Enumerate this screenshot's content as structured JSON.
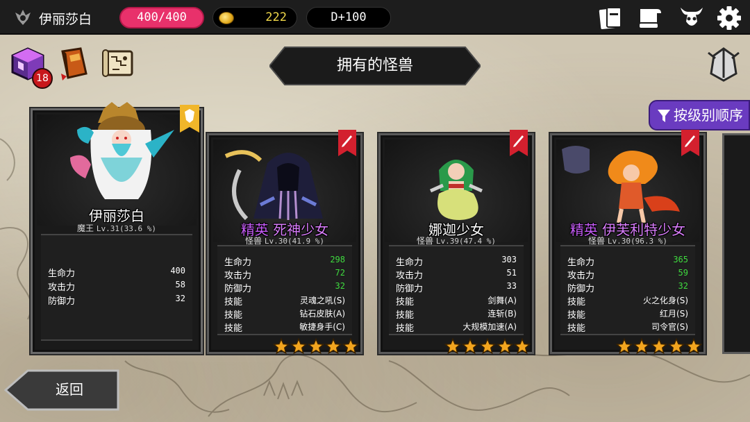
{
  "header": {
    "player_name": "伊丽莎白",
    "hp": "400/400",
    "gold": "222",
    "day": "D+100",
    "icons": [
      "cards-icon",
      "scroll-icon",
      "demon-icon",
      "gear-icon"
    ]
  },
  "menu": {
    "inventory_badge": "18",
    "icons": [
      "inventory-cube-icon",
      "book-icon",
      "map-scroll-icon"
    ]
  },
  "title": "拥有的怪兽",
  "sort_button": "按级别顺序",
  "back_button": "返回",
  "colors": {
    "hp": "#e8316b",
    "gold_text": "#f0d84a",
    "sort": "#6a3bc0",
    "elite": "#c45bf5",
    "stat_bonus": "#3fdc3f",
    "ribbon": "#d3202e"
  },
  "leader": {
    "name": "伊丽莎白",
    "role": "魔王",
    "level": "Lv.31(33.6 %)",
    "stats": [
      {
        "label": "生命力",
        "value": "400"
      },
      {
        "label": "攻击力",
        "value": "58"
      },
      {
        "label": "防御力",
        "value": "32"
      }
    ]
  },
  "monsters": [
    {
      "prefix": "精英",
      "name": "死神少女",
      "role": "怪兽",
      "level": "Lv.30(41.9 %)",
      "stars": 5,
      "stats": [
        {
          "label": "生命力",
          "value": "298",
          "bonus": true
        },
        {
          "label": "攻击力",
          "value": "72",
          "bonus": true
        },
        {
          "label": "防御力",
          "value": "32",
          "bonus": true
        },
        {
          "label": "技能",
          "value": "灵魂之吼(S)"
        },
        {
          "label": "技能",
          "value": "钻石皮肤(A)"
        },
        {
          "label": "技能",
          "value": "敏捷身手(C)"
        }
      ]
    },
    {
      "prefix": "",
      "name": "娜迦少女",
      "role": "怪兽",
      "level": "Lv.39(47.4 %)",
      "stars": 5,
      "stats": [
        {
          "label": "生命力",
          "value": "303",
          "bonus": false
        },
        {
          "label": "攻击力",
          "value": "51",
          "bonus": false
        },
        {
          "label": "防御力",
          "value": "33",
          "bonus": false
        },
        {
          "label": "技能",
          "value": "剑舞(A)"
        },
        {
          "label": "技能",
          "value": "连斩(B)"
        },
        {
          "label": "技能",
          "value": "大规模加速(A)"
        }
      ]
    },
    {
      "prefix": "精英",
      "name": "伊芙利特少女",
      "role": "怪兽",
      "level": "Lv.30(96.3 %)",
      "stars": 5,
      "stats": [
        {
          "label": "生命力",
          "value": "365",
          "bonus": true
        },
        {
          "label": "攻击力",
          "value": "59",
          "bonus": true
        },
        {
          "label": "防御力",
          "value": "32",
          "bonus": true
        },
        {
          "label": "技能",
          "value": "火之化身(S)"
        },
        {
          "label": "技能",
          "value": "红月(S)"
        },
        {
          "label": "技能",
          "value": "司令官(S)"
        }
      ]
    }
  ]
}
